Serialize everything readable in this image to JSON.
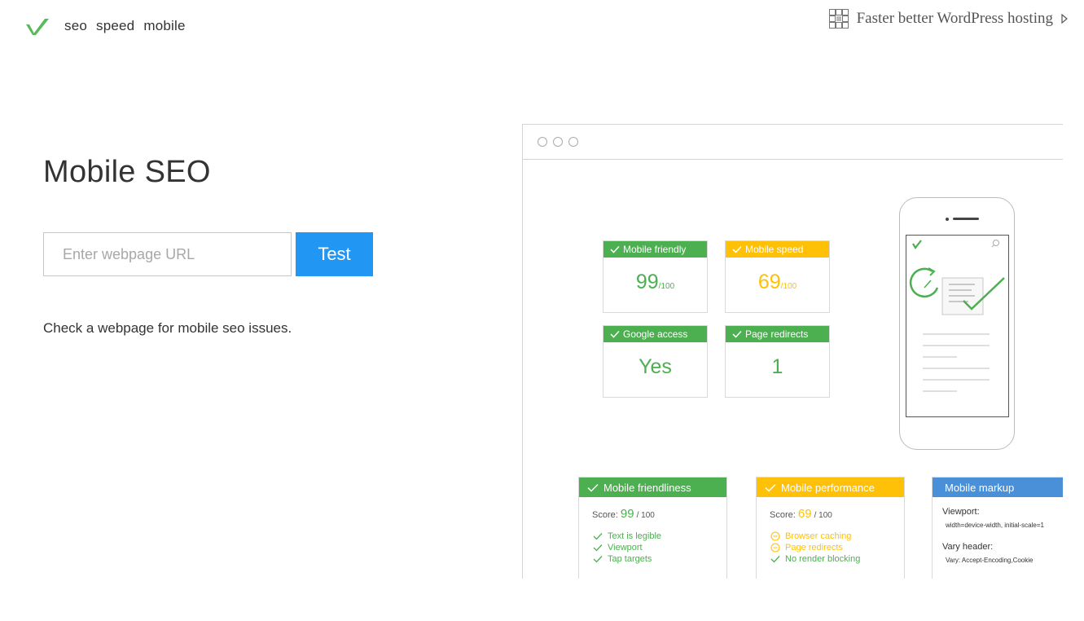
{
  "nav": {
    "links": [
      "seo",
      "speed",
      "mobile"
    ],
    "promo": "Faster better WordPress hosting"
  },
  "main": {
    "title": "Mobile SEO",
    "url_placeholder": "Enter webpage URL",
    "test_label": "Test",
    "description": "Check a webpage for mobile seo issues."
  },
  "illustration": {
    "cards": [
      {
        "label": "Mobile friendly",
        "value": "99",
        "suffix": "/100",
        "color": "#4caf50"
      },
      {
        "label": "Mobile speed",
        "value": "69",
        "suffix": "/100",
        "color": "#ffc107"
      },
      {
        "label": "Google access",
        "value": "Yes",
        "suffix": "",
        "color": "#4caf50"
      },
      {
        "label": "Page redirects",
        "value": "1",
        "suffix": "",
        "color": "#4caf50"
      }
    ],
    "panels": {
      "friendliness": {
        "title": "Mobile friendliness",
        "score_label": "Score:",
        "score": "99",
        "score_suffix": "/ 100",
        "items": [
          "Text is legible",
          "Viewport",
          "Tap targets"
        ]
      },
      "performance": {
        "title": "Mobile performance",
        "score_label": "Score:",
        "score": "69",
        "score_suffix": "/ 100",
        "items": [
          "Browser caching",
          "Page redirects",
          "No render blocking"
        ]
      },
      "markup": {
        "title": "Mobile markup",
        "viewport_label": "Viewport:",
        "viewport_value": "width=device-width, initial-scale=1",
        "vary_label": "Vary header:",
        "vary_value": "Vary: Accept-Encoding,Cookie"
      }
    }
  },
  "colors": {
    "accent": "#2196f3",
    "green": "#4caf50",
    "yellow": "#ffc107",
    "blue": "#4a90d9",
    "logo": "#5cb85c"
  },
  "icons": [
    "logo-check",
    "grid-icon",
    "play-triangle-icon",
    "check-icon",
    "minus-circle-icon",
    "search-icon"
  ]
}
